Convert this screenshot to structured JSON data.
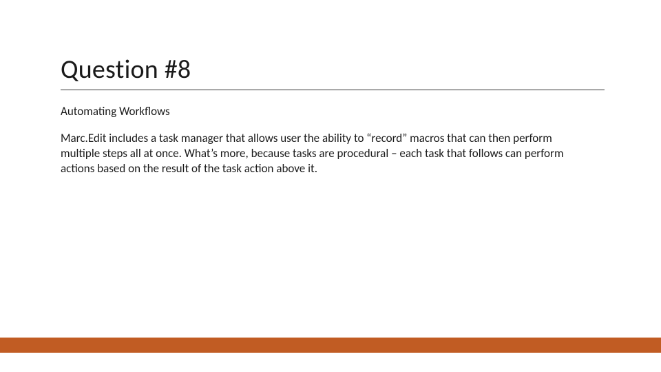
{
  "slide": {
    "title": "Question #8",
    "subtitle": "Automating Workflows",
    "body": "Marc.Edit includes a task manager that allows user the ability to “record” macros that can then perform multiple steps all at once.  What’s more, because tasks are procedural – each task that follows can perform actions based on the result of the task action above it."
  },
  "colors": {
    "accent": "#c15c23"
  }
}
